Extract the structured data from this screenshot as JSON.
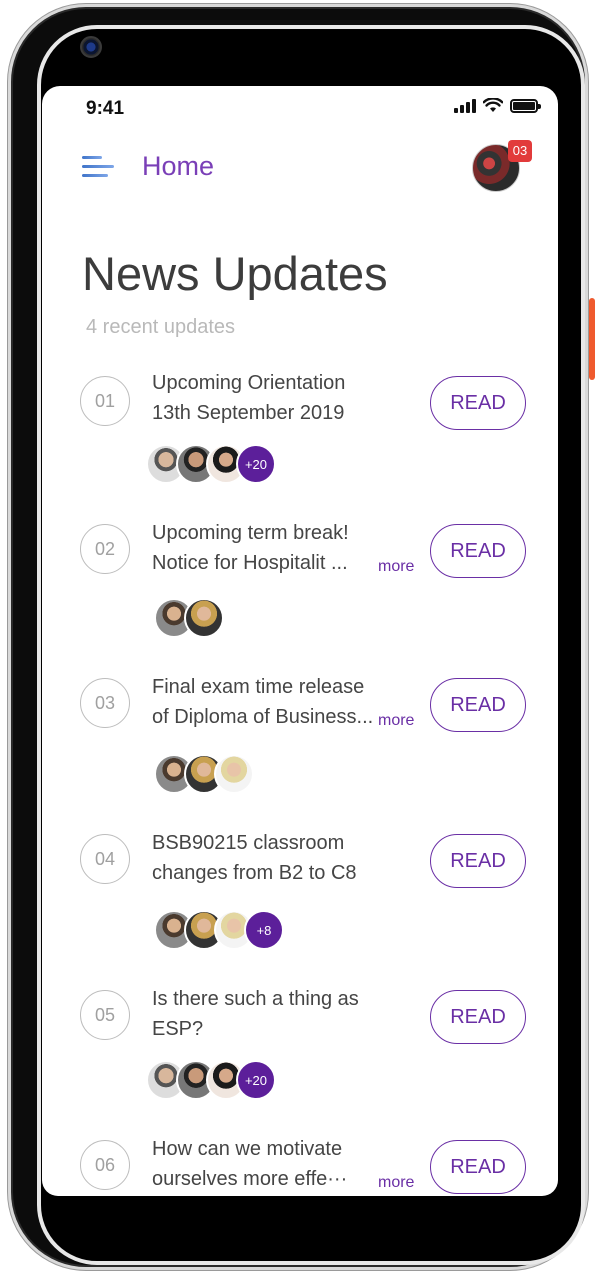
{
  "status_bar": {
    "time": "9:41"
  },
  "header": {
    "title": "Home",
    "notification_count": "03"
  },
  "page": {
    "title": "News Updates",
    "subtitle": "4 recent updates"
  },
  "read_label": "READ",
  "more_label": "more",
  "updates": [
    {
      "number": "01",
      "line1": "Upcoming Orientation",
      "line2": "13th September 2019",
      "more": "",
      "extra_count": "+20"
    },
    {
      "number": "02",
      "line1": "Upcoming term break!",
      "line2": "Notice for Hospitalit ...",
      "more": "more",
      "extra_count": ""
    },
    {
      "number": "03",
      "line1": "Final exam time release",
      "line2": "of Diploma of Business...",
      "more": "more",
      "extra_count": ""
    },
    {
      "number": "04",
      "line1": "BSB90215 classroom",
      "line2": "changes from B2 to C8",
      "more": "",
      "extra_count": "+8"
    },
    {
      "number": "05",
      "line1": "Is there such a thing as",
      "line2": "ESP?",
      "more": "",
      "extra_count": "+20"
    },
    {
      "number": "06",
      "line1": "How can we motivate",
      "line2": "ourselves more effe···",
      "more": "more",
      "extra_count": ""
    }
  ],
  "colors": {
    "accent": "#6a2fa5",
    "header_title": "#7a3fb7",
    "badge": "#e23b3b",
    "avatar_more": "#5c1f9a"
  }
}
